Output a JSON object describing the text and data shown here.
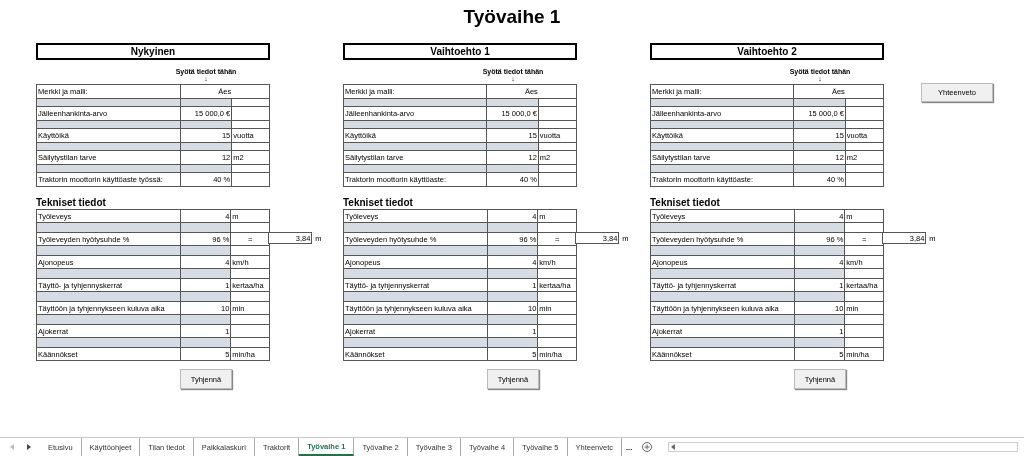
{
  "title": "Työvaihe 1",
  "sections": [
    {
      "heading": "Nykyinen",
      "input_hint": "Syötä tiedot tähän",
      "input_arrow": "↓",
      "basic_rows": [
        {
          "kind": "merged",
          "label": "Merkki ja malli:",
          "value": "Äes"
        },
        {
          "kind": "plain",
          "label": "Jälleenhankinta-arvo",
          "value": "15 000,0 €"
        },
        {
          "kind": "plain",
          "label": "Käyttöikä",
          "value": "15",
          "unit": "vuotta"
        },
        {
          "kind": "plain",
          "label": "Säilytystilan tarve",
          "value": "12",
          "unit": "m2"
        },
        {
          "kind": "plain",
          "label": "Traktorin moottorin käyttöaste työssä:",
          "value": "40 %"
        }
      ],
      "tech_heading": "Tekniset tiedot",
      "tech_rows": [
        {
          "kind": "plain",
          "label": "Työleveys",
          "value": "4",
          "unit": "m"
        },
        {
          "kind": "calc",
          "label": "Työleveyden hyötysuhde %",
          "value": "96 %",
          "unit": "=",
          "result": "3,84",
          "result_unit": "m"
        },
        {
          "kind": "plain",
          "label": "Ajonopeus",
          "value": "4",
          "unit": "km/h"
        },
        {
          "kind": "plain",
          "label": "Täyttö- ja tyhjennyskerrat",
          "value": "1",
          "unit": "kertaa/ha"
        },
        {
          "kind": "plain",
          "label": "Täyttöön ja tyhjennykseen kuluva aika",
          "value": "10",
          "unit": "min"
        },
        {
          "kind": "plain",
          "label": "Ajokerrat",
          "value": "1"
        },
        {
          "kind": "plain",
          "label": "Käännökset",
          "value": "5",
          "unit": "min/ha"
        }
      ],
      "clear_button": "Tyhjennä"
    },
    {
      "heading": "Vaihtoehto 1",
      "input_hint": "Syötä tiedot tähän",
      "input_arrow": "↓",
      "basic_rows": [
        {
          "kind": "merged",
          "label": "Merkki ja malli:",
          "value": "Äes"
        },
        {
          "kind": "plain",
          "label": "Jälleenhankinta-arvo",
          "value": "15 000,0 €"
        },
        {
          "kind": "plain",
          "label": "Käyttöikä",
          "value": "15",
          "unit": "vuotta"
        },
        {
          "kind": "plain",
          "label": "Säilytystilan tarve",
          "value": "12",
          "unit": "m2"
        },
        {
          "kind": "plain",
          "label": "Traktorin moottorin käyttöaste:",
          "value": "40 %"
        }
      ],
      "tech_heading": "Tekniset tiedot",
      "tech_rows": [
        {
          "kind": "plain",
          "label": "Työleveys",
          "value": "4",
          "unit": "m"
        },
        {
          "kind": "calc",
          "label": "Työleveyden hyötysuhde %",
          "value": "96 %",
          "unit": "=",
          "result": "3,84",
          "result_unit": "m"
        },
        {
          "kind": "plain",
          "label": "Ajonopeus",
          "value": "4",
          "unit": "km/h"
        },
        {
          "kind": "plain",
          "label": "Täyttö- ja tyhjennyskerrat",
          "value": "1",
          "unit": "kertaa/ha"
        },
        {
          "kind": "plain",
          "label": "Täyttöön ja tyhjennykseen kuluva aika",
          "value": "10",
          "unit": "min"
        },
        {
          "kind": "plain",
          "label": "Ajokerrat",
          "value": "1"
        },
        {
          "kind": "plain",
          "label": "Käännökset",
          "value": "5",
          "unit": "min/ha"
        }
      ],
      "clear_button": "Tyhjennä"
    },
    {
      "heading": "Vaihtoehto 2",
      "input_hint": "Syötä tiedot tähän",
      "input_arrow": "↓",
      "basic_rows": [
        {
          "kind": "merged",
          "label": "Merkki ja malli:",
          "value": "Äes"
        },
        {
          "kind": "plain",
          "label": "Jälleenhankinta-arvo",
          "value": "15 000,0 €"
        },
        {
          "kind": "plain",
          "label": "Käyttöikä",
          "value": "15",
          "unit": "vuotta"
        },
        {
          "kind": "plain",
          "label": "Säilytystilan tarve",
          "value": "12",
          "unit": "m2"
        },
        {
          "kind": "plain",
          "label": "Traktorin moottorin käyttöaste:",
          "value": "40 %"
        }
      ],
      "tech_heading": "Tekniset tiedot",
      "tech_rows": [
        {
          "kind": "plain",
          "label": "Työleveys",
          "value": "4",
          "unit": "m"
        },
        {
          "kind": "calc",
          "label": "Työleveyden hyötysuhde %",
          "value": "96 %",
          "unit": "=",
          "result": "3,84",
          "result_unit": "m"
        },
        {
          "kind": "plain",
          "label": "Ajonopeus",
          "value": "4",
          "unit": "km/h"
        },
        {
          "kind": "plain",
          "label": "Täyttö- ja tyhjennyskerrat",
          "value": "1",
          "unit": "kertaa/ha"
        },
        {
          "kind": "plain",
          "label": "Täyttöön ja tyhjennykseen kuluva aika",
          "value": "10",
          "unit": "min"
        },
        {
          "kind": "plain",
          "label": "Ajokerrat",
          "value": "1"
        },
        {
          "kind": "plain",
          "label": "Käännökset",
          "value": "5",
          "unit": "min/ha"
        }
      ],
      "clear_button": "Tyhjennä"
    }
  ],
  "summary_button": "Yhteenveto",
  "sheet_tabs": [
    {
      "label": "Etusivu",
      "selected": false
    },
    {
      "label": "Käyttöohjeet",
      "selected": false
    },
    {
      "label": "Tilan tiedot",
      "selected": false
    },
    {
      "label": "Palkkalaskuri",
      "selected": false
    },
    {
      "label": "Traktorit",
      "selected": false
    },
    {
      "label": "Työvaihe 1",
      "selected": true
    },
    {
      "label": "Työvaihe 2",
      "selected": false
    },
    {
      "label": "Työvaihe 3",
      "selected": false
    },
    {
      "label": "Työvaihe 4",
      "selected": false
    },
    {
      "label": "Työvaihe 5",
      "selected": false
    },
    {
      "label": "Yhteenvetc",
      "selected": false
    }
  ],
  "more_tabs": "..."
}
